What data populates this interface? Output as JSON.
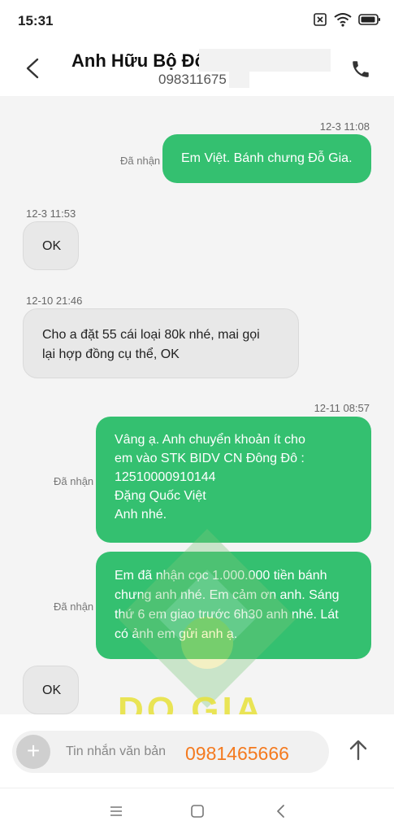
{
  "status_bar": {
    "time": "15:31"
  },
  "header": {
    "contact_name": "Anh Hữu Bộ Đội",
    "contact_number": "098311675"
  },
  "messages": [
    {
      "direction": "out",
      "timestamp": "12-3 11:08",
      "status": "Đã nhận",
      "lines": [
        "Em Việt. Bánh chưng Đỗ Gia."
      ]
    },
    {
      "direction": "in",
      "timestamp": "12-3 11:53",
      "lines": [
        "OK"
      ]
    },
    {
      "direction": "in",
      "timestamp": "12-10 21:46",
      "lines": [
        "Cho a đặt 55 cái loại 80k nhé, mai gọi",
        "lại hợp đồng cụ thể, OK"
      ]
    },
    {
      "direction": "out",
      "timestamp": "12-11 08:57",
      "status": "Đã nhận",
      "lines": [
        "Vâng ạ. Anh chuyển khoản ít cho",
        "em vào STK BIDV CN Đông Đô :",
        "12510000910144",
        "Đặng Quốc Việt",
        "Anh nhé."
      ]
    },
    {
      "direction": "out",
      "status": "Đã nhận",
      "lines": [
        "Em đã nhận cọc 1.000.000 tiền bánh",
        "chưng anh nhé. Em cảm ơn anh. Sáng",
        "thứ 6 em giao trước 6h30 anh nhé. Lát",
        "có ảnh em gửi anh ạ."
      ]
    },
    {
      "direction": "in",
      "lines": [
        "OK"
      ]
    }
  ],
  "watermark": {
    "text": "DO GIA"
  },
  "composer": {
    "placeholder": "Tin nhắn văn bản",
    "phone_overlay": "0981465666"
  },
  "colors": {
    "outgoing_bubble": "#34c070",
    "incoming_bubble": "#e8e8e8",
    "overlay_phone": "#f47a1f"
  }
}
